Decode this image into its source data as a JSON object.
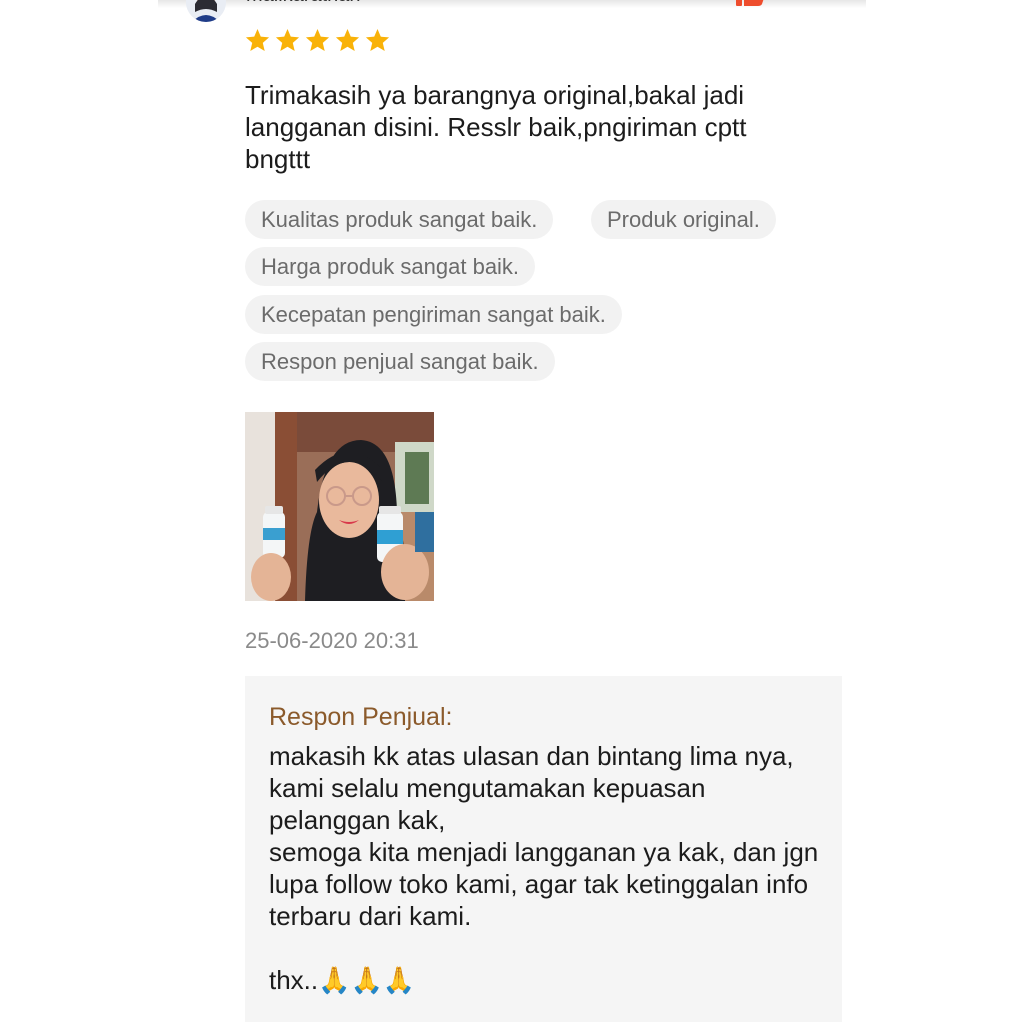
{
  "reviewer": {
    "username": "malikarathan"
  },
  "rating": {
    "stars": 5,
    "max": 5,
    "star_color": "#F9B208"
  },
  "review": {
    "text": "Trimakasih ya barangnya original,bakal jadi langganan disini. Resslr baik,pngiriman cptt bngttt",
    "tags": [
      "Kualitas produk sangat baik.",
      "Produk original.",
      "Harga produk sangat baik.",
      "Kecepatan pengiriman sangat baik.",
      "Respon penjual sangat baik."
    ],
    "timestamp": "25-06-2020 20:31"
  },
  "seller_response": {
    "title": "Respon Penjual:",
    "body": "makasih kk atas ulasan dan bintang lima nya, kami selalu mengutamakan kepuasan pelanggan kak,\nsemoga kita menjadi langganan ya kak, dan jgn lupa follow toko kami, agar tak ketinggalan info terbaru dari kami.\n\nthx..🙏🙏🙏",
    "title_color": "#8B5A2B",
    "background": "#F5F5F5"
  },
  "colors": {
    "accent": "#EE4D2D",
    "tag_background": "#F2F2F2",
    "tag_text": "#6B6B6B"
  },
  "icons": {
    "like": "thumbs-up-icon",
    "star": "star-icon"
  }
}
